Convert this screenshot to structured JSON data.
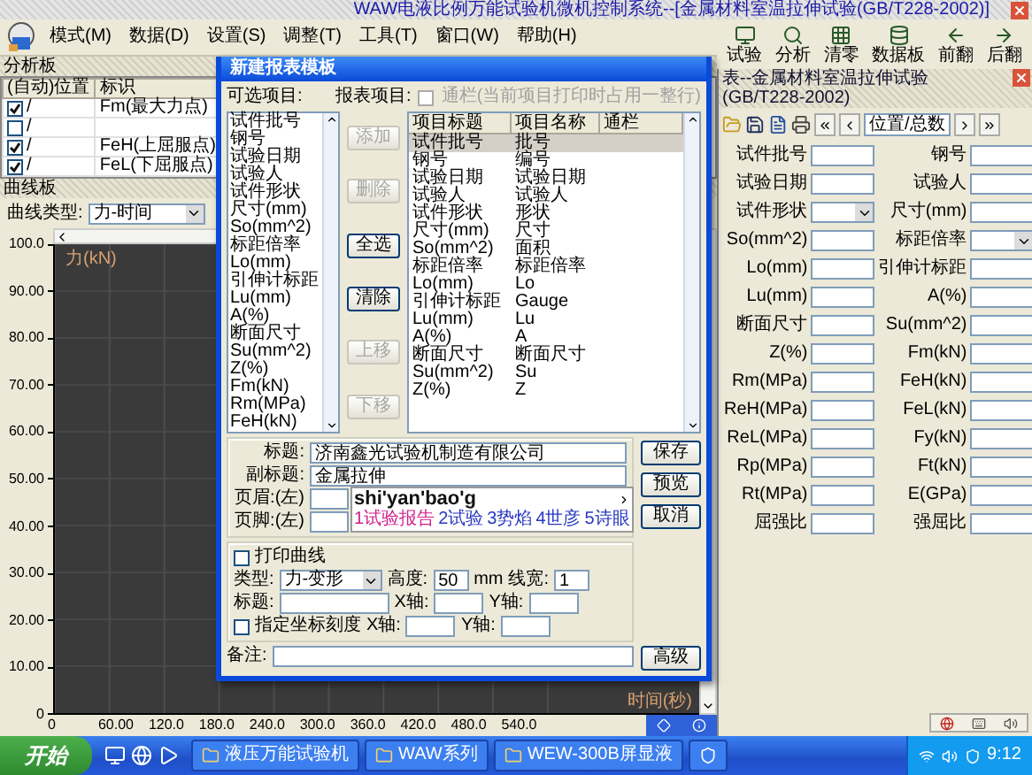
{
  "window": {
    "title": "WAW电液比例万能试验机微机控制系统--[金属材料室温拉伸试验(GB/T228-2002)]"
  },
  "menu": [
    "模式(M)",
    "数据(D)",
    "设置(S)",
    "调整(T)",
    "工具(T)",
    "窗口(W)",
    "帮助(H)"
  ],
  "toolbar": [
    "试验",
    "分析",
    "清零",
    "数据板",
    "前翻",
    "后翻"
  ],
  "analysis_panel": {
    "title": "分析板",
    "columns": [
      "(自动)位置",
      "标识"
    ],
    "rows": [
      {
        "checked": true,
        "position": "/",
        "label": "Fm(最大力点)"
      },
      {
        "checked": false,
        "position": "/"
      },
      {
        "checked": true,
        "position": "/",
        "label": "FeH(上屈服点)"
      },
      {
        "checked": true,
        "position": "/",
        "label": "FeL(下屈服点)"
      }
    ]
  },
  "curve_panel": {
    "title": "曲线板",
    "type_label": "曲线类型:",
    "type_value": "力-时间",
    "chart": {
      "ylabel": "力(kN)",
      "xlabel": "时间(秒)",
      "yticks": [
        "100.0",
        "90.00",
        "80.00",
        "70.00",
        "60.00",
        "50.00",
        "40.00",
        "30.00",
        "20.00",
        "10.00",
        "0"
      ],
      "xticks": [
        "0",
        "60.00",
        "120.0",
        "180.0",
        "240.0",
        "300.0",
        "360.0",
        "420.0",
        "480.0",
        "540.0"
      ]
    }
  },
  "dialog": {
    "title": "新建报表模板",
    "available_label": "可选项目:",
    "available_items": [
      "试件批号",
      "钢号",
      "试验日期",
      "试验人",
      "试件形状",
      "尺寸(mm)",
      "So(mm^2)",
      "标距倍率",
      "Lo(mm)",
      "引伸计标距",
      "Lu(mm)",
      "A(%)",
      "断面尺寸",
      "Su(mm^2)",
      "Z(%)",
      "Fm(kN)",
      "Rm(MPa)",
      "FeH(kN)"
    ],
    "buttons": [
      {
        "label": "添加",
        "disabled": true
      },
      {
        "label": "删除",
        "disabled": true
      },
      {
        "label": "全选",
        "disabled": false
      },
      {
        "label": "清除",
        "disabled": false
      },
      {
        "label": "上移",
        "disabled": true
      },
      {
        "label": "下移",
        "disabled": true
      }
    ],
    "report_label": "报表项目:",
    "span_option": {
      "label": "通栏(当前项目打印时占用一整行)",
      "checked": false,
      "disabled": true
    },
    "report_columns": [
      "项目标题",
      "项目名称",
      "通栏"
    ],
    "report_rows": [
      {
        "title": "试件批号",
        "name": "批号",
        "selected": true
      },
      {
        "title": "钢号",
        "name": "编号",
        "selected": false
      },
      {
        "title": "试验日期",
        "name": "试验日期",
        "selected": false
      },
      {
        "title": "试验人",
        "name": "试验人",
        "selected": false
      },
      {
        "title": "试件形状",
        "name": "形状",
        "selected": false
      },
      {
        "title": "尺寸(mm)",
        "name": "尺寸",
        "selected": false
      },
      {
        "title": "So(mm^2)",
        "name": "面积",
        "selected": false
      },
      {
        "title": "标距倍率",
        "name": "标距倍率",
        "selected": false
      },
      {
        "title": "Lo(mm)",
        "name": "Lo",
        "selected": false
      },
      {
        "title": "引伸计标距",
        "name": "Gauge",
        "selected": false
      },
      {
        "title": "Lu(mm)",
        "name": "Lu",
        "selected": false
      },
      {
        "title": "A(%)",
        "name": "A",
        "selected": false
      },
      {
        "title": "断面尺寸",
        "name": "断面尺寸",
        "selected": false
      },
      {
        "title": "Su(mm^2)",
        "name": "Su",
        "selected": false
      },
      {
        "title": "Z(%)",
        "name": "Z",
        "selected": false
      }
    ],
    "fields": [
      {
        "label": "标题:",
        "value": "济南鑫光试验机制造有限公司"
      },
      {
        "label": "副标题:",
        "value": "金属拉伸"
      },
      {
        "label": "页眉:(左)"
      },
      {
        "label": "页脚:(左)"
      }
    ],
    "actions": [
      "保存",
      "预览",
      "取消"
    ],
    "ime": {
      "input": "shi'yan'bao'g",
      "candidates": [
        {
          "label": "1试验报告",
          "selected": true
        },
        {
          "label": "2试验",
          "selected": false
        },
        {
          "label": "3势焰",
          "selected": false
        },
        {
          "label": "4世彦",
          "selected": false
        },
        {
          "label": "5诗眼",
          "selected": false
        }
      ]
    },
    "print_curve": {
      "label": "打印曲线",
      "checked": false,
      "type_label": "类型:",
      "type_value": "力-变形",
      "height_label": "高度:",
      "height_value": "50",
      "unit": "mm",
      "width_label": "线宽:",
      "width_value": "1",
      "title_label": "标题:",
      "x_label": "X轴:",
      "y_label": "Y轴:"
    },
    "scale_option": {
      "label": "指定坐标刻度",
      "checked": false,
      "x_label": "X轴:",
      "y_label": "Y轴:"
    },
    "note_label": "备注:",
    "advanced": "高级"
  },
  "report_panel": {
    "title": "表--金属材料室温拉伸试验(GB/T228-2002)",
    "position": "位置/总数",
    "fields": [
      {
        "label": "试件批号",
        "kind": "text"
      },
      {
        "label": "钢号",
        "kind": "text"
      },
      {
        "label": "试验日期",
        "kind": "text"
      },
      {
        "label": "试验人",
        "kind": "text"
      },
      {
        "label": "试件形状",
        "kind": "select"
      },
      {
        "label": "尺寸(mm)",
        "kind": "text"
      },
      {
        "label": "So(mm^2)",
        "kind": "text"
      },
      {
        "label": "标距倍率",
        "kind": "select"
      },
      {
        "label": "Lo(mm)",
        "kind": "text"
      },
      {
        "label": "引伸计标距",
        "kind": "text"
      },
      {
        "label": "Lu(mm)",
        "kind": "text"
      },
      {
        "label": "A(%)",
        "kind": "text"
      },
      {
        "label": "断面尺寸",
        "kind": "text"
      },
      {
        "label": "Su(mm^2)",
        "kind": "text"
      },
      {
        "label": "Z(%)",
        "kind": "text"
      },
      {
        "label": "Fm(kN)",
        "kind": "text"
      },
      {
        "label": "Rm(MPa)",
        "kind": "text"
      },
      {
        "label": "FeH(kN)",
        "kind": "text"
      },
      {
        "label": "ReH(MPa)",
        "kind": "text"
      },
      {
        "label": "FeL(kN)",
        "kind": "text"
      },
      {
        "label": "ReL(MPa)",
        "kind": "text"
      },
      {
        "label": "Fy(kN)",
        "kind": "text"
      },
      {
        "label": "Rp(MPa)",
        "kind": "text"
      },
      {
        "label": "Ft(kN)",
        "kind": "text"
      },
      {
        "label": "Rt(MPa)",
        "kind": "text"
      },
      {
        "label": "E(GPa)",
        "kind": "text"
      },
      {
        "label": "屈强比",
        "kind": "text"
      },
      {
        "label": "强屈比",
        "kind": "text"
      }
    ]
  },
  "taskbar": {
    "start": "开始",
    "tasks": [
      {
        "kind": "window",
        "label": "液压万能试验机"
      },
      {
        "kind": "window",
        "label": "WAW系列"
      },
      {
        "kind": "window",
        "label": "WEW-300B屏显液"
      },
      {
        "kind": "icon"
      }
    ],
    "clock": "9:12"
  }
}
